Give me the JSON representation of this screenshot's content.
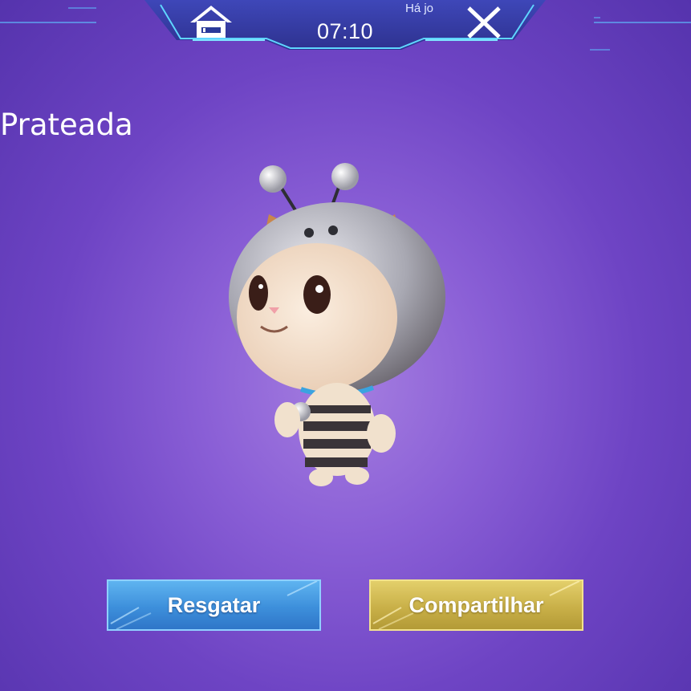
{
  "header": {
    "timer": "07:10",
    "hint_text": "Há jo",
    "home_icon": "home-icon",
    "close_icon": "close-icon"
  },
  "title": "Prateada",
  "character": {
    "icon": "silver-bee-cat-character"
  },
  "buttons": {
    "redeem_label": "Resgatar",
    "share_label": "Compartilhar"
  },
  "colors": {
    "background": "#7a4fd0",
    "blue_button": "#3d8fdb",
    "gold_button": "#c9b048",
    "header_panel": "#2a3a9a"
  }
}
